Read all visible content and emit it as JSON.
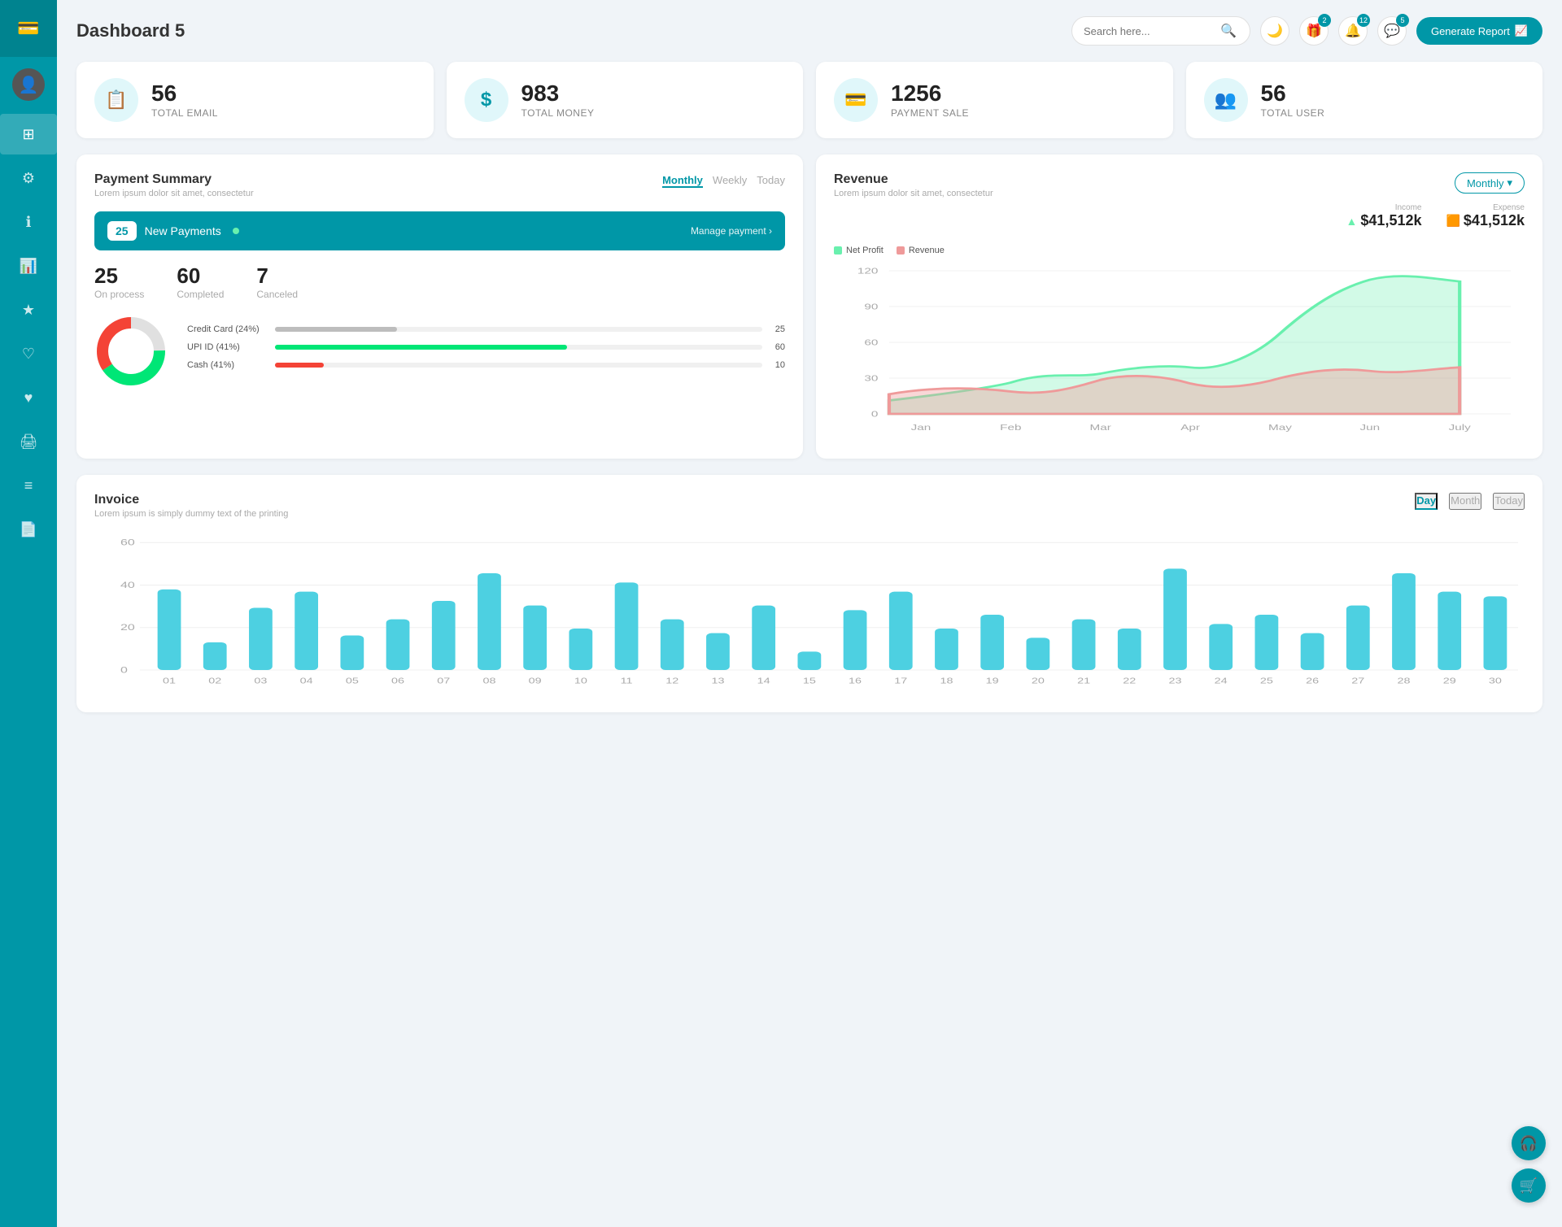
{
  "sidebar": {
    "logo_icon": "💳",
    "items": [
      {
        "id": "dashboard",
        "icon": "⊞",
        "active": true
      },
      {
        "id": "settings",
        "icon": "⚙"
      },
      {
        "id": "info",
        "icon": "ℹ"
      },
      {
        "id": "chart",
        "icon": "📊"
      },
      {
        "id": "star",
        "icon": "★"
      },
      {
        "id": "heart-outline",
        "icon": "♡"
      },
      {
        "id": "heart-filled",
        "icon": "♥"
      },
      {
        "id": "print",
        "icon": "🖨"
      },
      {
        "id": "list",
        "icon": "≡"
      },
      {
        "id": "file",
        "icon": "📄"
      }
    ]
  },
  "header": {
    "title": "Dashboard 5",
    "search_placeholder": "Search here...",
    "generate_btn": "Generate Report",
    "badges": {
      "gift": "2",
      "bell": "12",
      "chat": "5"
    }
  },
  "stats": [
    {
      "id": "total-email",
      "number": "56",
      "label": "TOTAL EMAIL",
      "icon": "📋"
    },
    {
      "id": "total-money",
      "number": "983",
      "label": "TOTAL MONEY",
      "icon": "$"
    },
    {
      "id": "payment-sale",
      "number": "1256",
      "label": "PAYMENT SALE",
      "icon": "💳"
    },
    {
      "id": "total-user",
      "number": "56",
      "label": "TOTAL USER",
      "icon": "👥"
    }
  ],
  "payment_summary": {
    "title": "Payment Summary",
    "subtitle": "Lorem ipsum dolor sit amet, consectetur",
    "tabs": [
      "Monthly",
      "Weekly",
      "Today"
    ],
    "active_tab": "Monthly",
    "new_payments_count": "25",
    "new_payments_label": "New Payments",
    "manage_link": "Manage payment →",
    "stats": [
      {
        "number": "25",
        "label": "On process"
      },
      {
        "number": "60",
        "label": "Completed"
      },
      {
        "number": "7",
        "label": "Canceled"
      }
    ],
    "progress_bars": [
      {
        "label": "Credit Card (24%)",
        "value": 25,
        "color": "#bdbdbd",
        "pct": 25
      },
      {
        "label": "UPI ID (41%)",
        "value": 60,
        "color": "#00e676",
        "pct": 60
      },
      {
        "label": "Cash (41%)",
        "value": 10,
        "color": "#f44336",
        "pct": 10
      }
    ],
    "donut": {
      "segments": [
        {
          "color": "#e0e0e0",
          "pct": 24
        },
        {
          "color": "#00e676",
          "pct": 41
        },
        {
          "color": "#f44336",
          "pct": 35
        }
      ]
    }
  },
  "revenue": {
    "title": "Revenue",
    "subtitle": "Lorem ipsum dolor sit amet, consectetur",
    "dropdown_label": "Monthly",
    "income_label": "Income",
    "income_value": "$41,512k",
    "expense_label": "Expense",
    "expense_value": "$41,512k",
    "legend": [
      {
        "label": "Net Profit",
        "color": "#69f0ae"
      },
      {
        "label": "Revenue",
        "color": "#ef9a9a"
      }
    ],
    "y_labels": [
      "0",
      "30",
      "60",
      "90",
      "120"
    ],
    "x_labels": [
      "Jan",
      "Feb",
      "Mar",
      "Apr",
      "May",
      "Jun",
      "July"
    ]
  },
  "invoice": {
    "title": "Invoice",
    "subtitle": "Lorem ipsum is simply dummy text of the printing",
    "tabs": [
      "Day",
      "Month",
      "Today"
    ],
    "active_tab": "Day",
    "y_labels": [
      "0",
      "20",
      "40",
      "60"
    ],
    "x_labels": [
      "01",
      "02",
      "03",
      "04",
      "05",
      "06",
      "07",
      "08",
      "09",
      "10",
      "11",
      "12",
      "13",
      "14",
      "15",
      "16",
      "17",
      "18",
      "19",
      "20",
      "21",
      "22",
      "23",
      "24",
      "25",
      "26",
      "27",
      "28",
      "29",
      "30"
    ],
    "bar_values": [
      35,
      12,
      27,
      34,
      15,
      22,
      30,
      42,
      28,
      18,
      38,
      22,
      16,
      28,
      8,
      26,
      34,
      18,
      24,
      14,
      22,
      18,
      44,
      20,
      24,
      16,
      28,
      42,
      34,
      32
    ]
  },
  "float_buttons": [
    {
      "id": "support",
      "icon": "🎧"
    },
    {
      "id": "cart",
      "icon": "🛒"
    }
  ]
}
